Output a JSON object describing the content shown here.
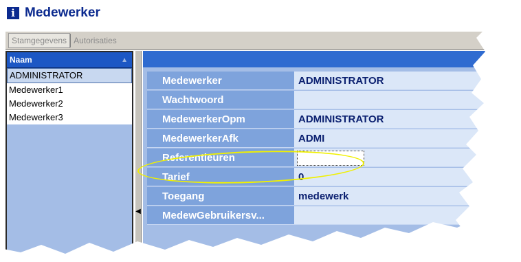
{
  "window": {
    "title": "Medewerker"
  },
  "tabs": [
    {
      "label": "Stamgegevens",
      "active": true
    },
    {
      "label": "Autorisaties",
      "active": false
    }
  ],
  "list": {
    "header": "Naam",
    "items": [
      "ADMINISTRATOR",
      "Medewerker1",
      "Medewerker2",
      "Medewerker3"
    ],
    "selected_index": 0
  },
  "fields": [
    {
      "label": "Medewerker",
      "value": "ADMINISTRATOR"
    },
    {
      "label": "Wachtwoord",
      "value": ""
    },
    {
      "label": "MedewerkerOpm",
      "value": "ADMINISTRATOR"
    },
    {
      "label": "MedewerkerAfk",
      "value": "ADMI"
    },
    {
      "label": "Referentieuren",
      "value": ""
    },
    {
      "label": "Tarief",
      "value": "0"
    },
    {
      "label": "Toegang",
      "value": "medewerk"
    },
    {
      "label": "MedewGebruikersv...",
      "value": ""
    }
  ],
  "colors": {
    "title": "#0b2a8f",
    "header_blue": "#2f6bd0",
    "label_blue": "#7ea3dc",
    "value_blue": "#dbe7f8",
    "highlight": "#f0f000"
  },
  "icons": {
    "app": "info-icon",
    "sort": "sort-triangle-icon",
    "splitter": "chevron-left-icon"
  }
}
